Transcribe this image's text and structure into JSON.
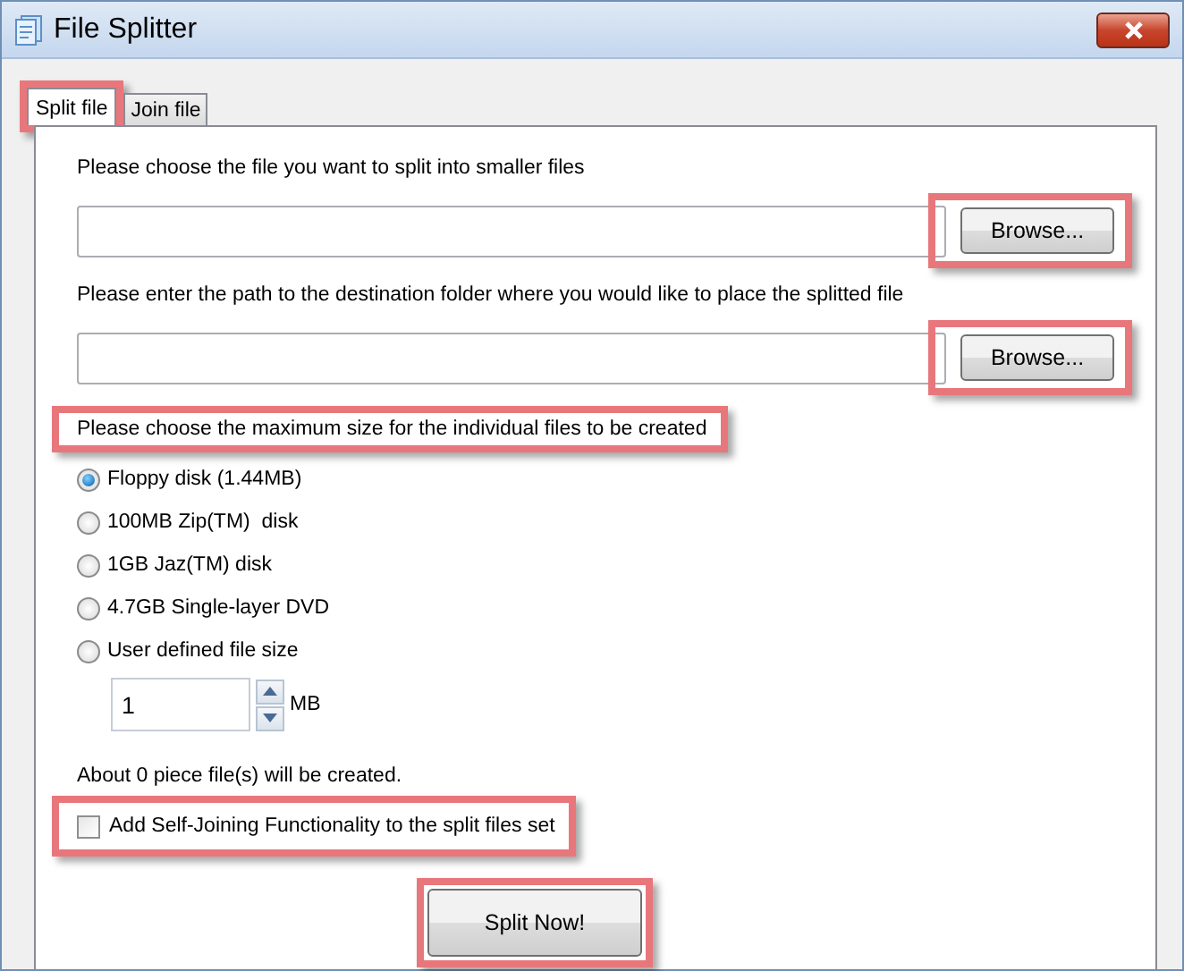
{
  "window": {
    "title": "File Splitter"
  },
  "tabs": [
    {
      "label": "Split file",
      "selected": true,
      "highlighted": true
    },
    {
      "label": "Join file",
      "selected": false,
      "highlighted": false
    }
  ],
  "source": {
    "label": "Please choose the file you want to split into smaller files",
    "button": "Browse...",
    "button_highlighted": true
  },
  "destination": {
    "label": "Please enter the path to the destination folder where you would like to place the splitted file",
    "button": "Browse...",
    "button_highlighted": true
  },
  "size": {
    "label": "Please choose the maximum size for the individual files to be created",
    "label_highlighted": true,
    "options": [
      {
        "label": "Floppy disk (1.44MB)",
        "selected": true
      },
      {
        "label": "100MB Zip(TM)  disk",
        "selected": false
      },
      {
        "label": "1GB Jaz(TM) disk",
        "selected": false
      },
      {
        "label": "4.7GB Single-layer DVD",
        "selected": false
      },
      {
        "label": "User defined file size",
        "selected": false
      }
    ],
    "custom": {
      "value": "1",
      "unit": "MB"
    }
  },
  "estimate": "About 0 piece file(s) will be created.",
  "self_joining": {
    "label": "Add Self-Joining Functionality to the split files set",
    "checked": false,
    "highlighted": true
  },
  "split_button": {
    "label": "Split Now!",
    "highlighted": true
  }
}
